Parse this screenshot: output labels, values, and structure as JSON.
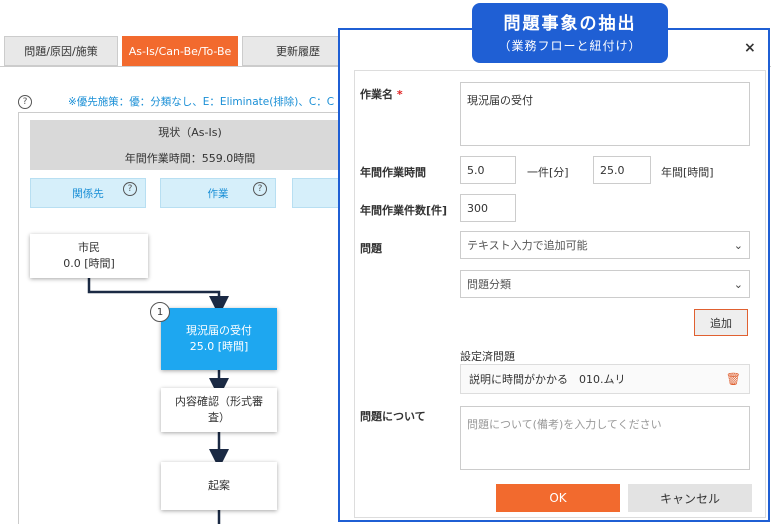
{
  "tabs": [
    {
      "label": "問題/原因/施策"
    },
    {
      "label": "As-Is/Can-Be/To-Be"
    },
    {
      "label": "更新履歴"
    }
  ],
  "note": {
    "text": "※優先施策：優：分類なし、E：Eliminate(排除)、C：C"
  },
  "asis": {
    "title": "現状（As-Is)",
    "annual_time": "年間作業時間：559.0時間"
  },
  "columns": {
    "c1": "関係先",
    "c2": "作業",
    "help": "?"
  },
  "nodes": {
    "citizen": {
      "name": "市民",
      "time": "0.0 [時間]"
    },
    "reception": {
      "name": "現況届の受付",
      "time": "25.0 [時間]",
      "badge": "1"
    },
    "check": {
      "name": "内容確認（形式審査）"
    },
    "draft": {
      "name": "起案"
    }
  },
  "callout": {
    "title": "問題事象の抽出",
    "subtitle": "（業務フローと紐付け）"
  },
  "dialog": {
    "close": "×",
    "task_name_label": "作業名",
    "required_mark": "*",
    "task_name_value": "現況届の受付",
    "annual_time_label": "年間作業時間",
    "per_case_value": "5.0",
    "per_case_unit": "一件[分]",
    "annual_value": "25.0",
    "annual_unit": "年間[時間]",
    "case_count_label": "年間作業件数[件]",
    "case_count_value": "300",
    "problem_label": "問題",
    "problem_select": "テキスト入力で追加可能",
    "category_select": "問題分類",
    "add_button": "追加",
    "set_problems_label": "設定済問題",
    "set_problem_text": "説明に時間がかかる　010.ムリ",
    "about_label": "問題について",
    "about_placeholder": "問題について(備考)を入力してください",
    "ok": "OK",
    "cancel": "キャンセル"
  },
  "colors": {
    "accent": "#f26a2e",
    "dialog_border": "#1f5fd4",
    "node_blue": "#1ea7f0"
  }
}
